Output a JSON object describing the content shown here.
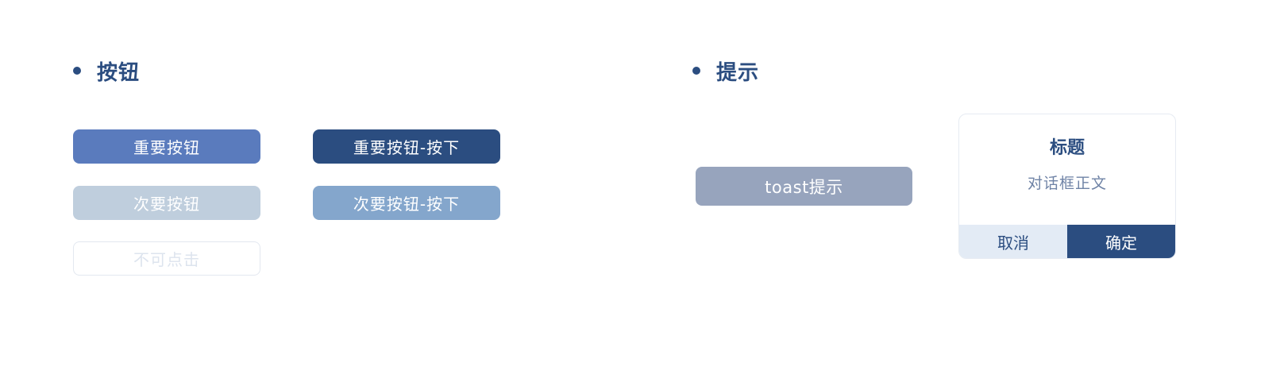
{
  "colors": {
    "accent_dark": "#2b4d80",
    "primary": "#5a7bbd",
    "secondary": "#bfcedd",
    "secondary_pressed": "#84a6cc",
    "disabled_text": "#dde4ee",
    "toast_bg": "#97a4bd",
    "dialog_cancel_bg": "#e3ebf5",
    "dialog_body_text": "#6f83a6"
  },
  "buttons_section": {
    "title": "按钮",
    "primary_label": "重要按钮",
    "primary_pressed_label": "重要按钮-按下",
    "secondary_label": "次要按钮",
    "secondary_pressed_label": "次要按钮-按下",
    "disabled_label": "不可点击"
  },
  "tips_section": {
    "title": "提示",
    "toast_text": "toast提示",
    "dialog": {
      "title": "标题",
      "body": "对话框正文",
      "cancel_label": "取消",
      "confirm_label": "确定"
    }
  }
}
